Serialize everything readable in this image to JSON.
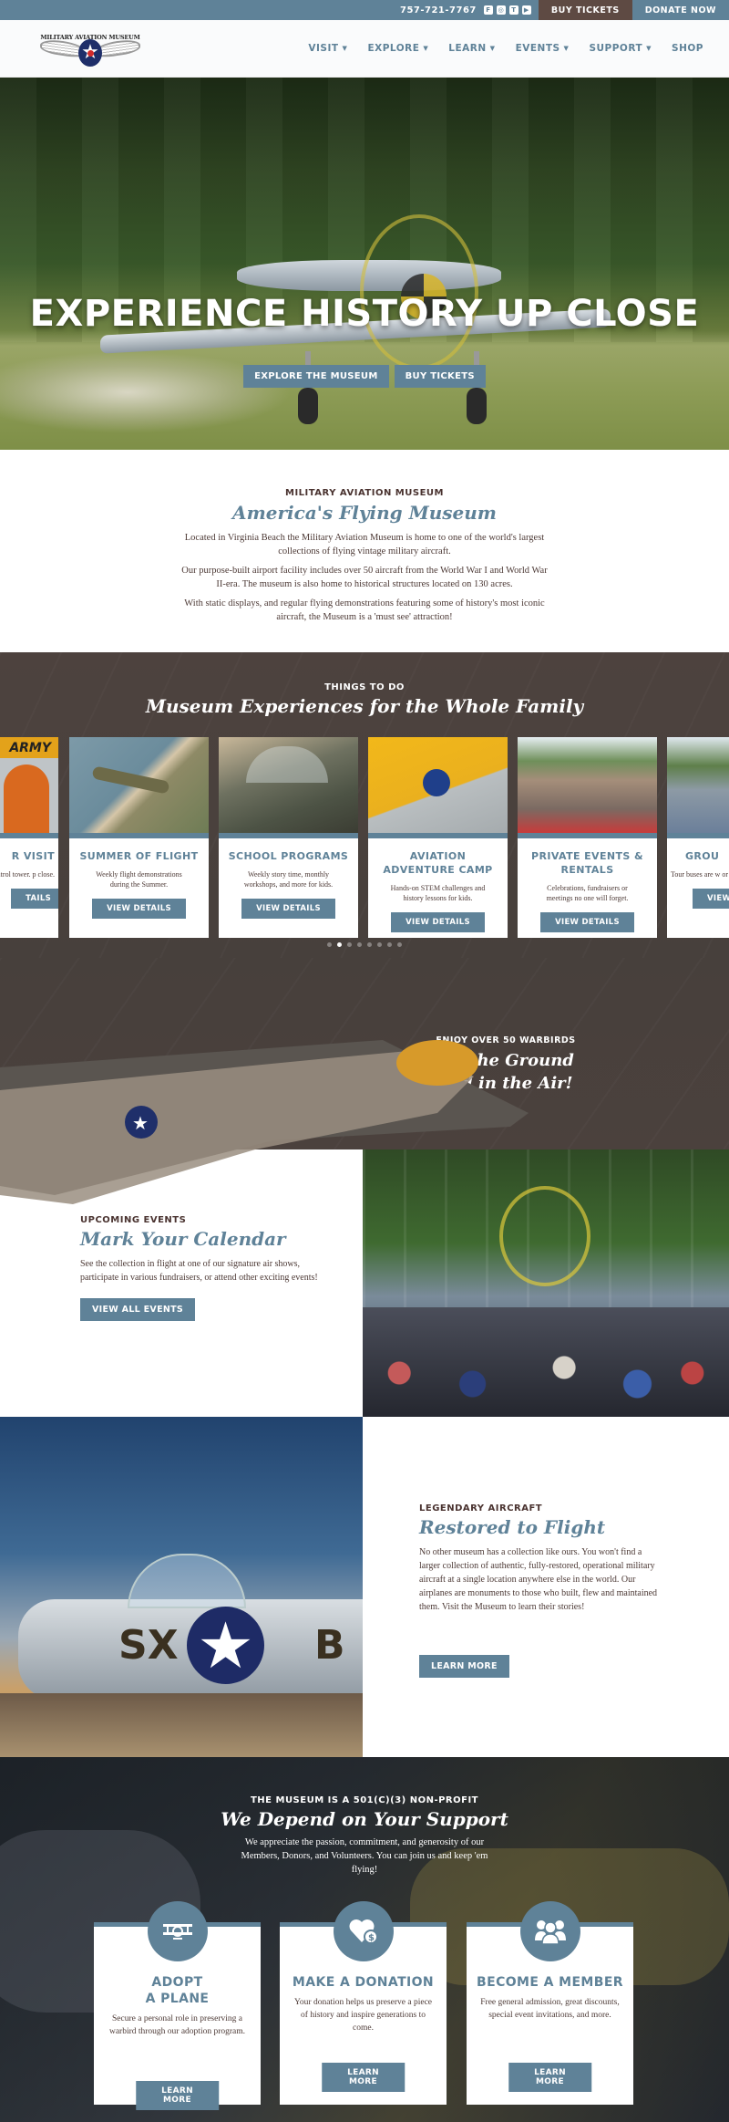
{
  "topbar": {
    "phone": "757-721-7767",
    "socials": [
      "facebook-icon",
      "instagram-icon",
      "twitter-icon",
      "youtube-icon"
    ],
    "buy_tickets": "Buy Tickets",
    "donate_now": "Donate Now"
  },
  "header": {
    "logo_text": "MILITARY AVIATION MUSEUM",
    "nav": [
      {
        "label": "Visit",
        "has_dropdown": true
      },
      {
        "label": "Explore",
        "has_dropdown": true
      },
      {
        "label": "Learn",
        "has_dropdown": true
      },
      {
        "label": "Events",
        "has_dropdown": true
      },
      {
        "label": "Support",
        "has_dropdown": true
      },
      {
        "label": "Shop",
        "has_dropdown": false
      }
    ],
    "chevron": "⌄"
  },
  "hero": {
    "title": "EXPERIENCE HISTORY UP CLOSE",
    "buttons": [
      "Explore the Museum",
      "Buy Tickets"
    ]
  },
  "intro": {
    "eyebrow": "Military Aviation Museum",
    "title": "America's Flying Museum",
    "paragraphs": [
      "Located in Virginia Beach the Military Aviation Museum is home to one of the world's largest collections of flying vintage military aircraft.",
      "Our purpose-built airport facility includes over 50 aircraft from the World War I and World War II-era. The museum is also home to historical structures located on 130 acres.",
      "With static displays, and regular flying demonstrations featuring some of history's most iconic aircraft, the Museum is a 'must see' attraction!"
    ]
  },
  "things": {
    "eyebrow": "Things to Do",
    "title": "Museum Experiences for the Whole Family",
    "cards": [
      {
        "title": "R VISIT",
        "desc": "control tower. p close.",
        "button": "TAILS"
      },
      {
        "title": "Summer of Flight",
        "desc": "Weekly flight demonstrations during the Summer.",
        "button": "View Details"
      },
      {
        "title": "School Programs",
        "desc": "Weekly story time, monthly workshops, and more for kids.",
        "button": "View Details"
      },
      {
        "title": "Aviation Adventure Camp",
        "desc": "Hands-on STEM challenges and history lessons for kids.",
        "button": "View Details"
      },
      {
        "title": "Private Events & Rentals",
        "desc": "Celebrations, fundraisers or meetings no one will forget.",
        "button": "View Details"
      },
      {
        "title": "GROU",
        "desc": "Tour buses are w or witl",
        "button": "VIEW"
      }
    ],
    "dots_total": 8,
    "dots_active_index": 1
  },
  "warbirds": {
    "eyebrow": "Enjoy Over 50 Warbirds",
    "title_line1": "On the Ground",
    "title_line2": "and in the Air!"
  },
  "events": {
    "eyebrow": "Upcoming Events",
    "title": "Mark Your Calendar",
    "body": "See the collection in flight at one of our signature air shows, participate in various fundraisers, or attend other exciting events!",
    "button": "View All Events"
  },
  "legendary": {
    "eyebrow": "Legendary Aircraft",
    "title": "Restored to Flight",
    "body": "No other museum has a collection like ours. You won't find a larger collection of authentic, fully-restored, operational military aircraft at a single location anywhere else in the world. Our airplanes are monuments to those who built, flew and maintained them. Visit the Museum to learn their stories!",
    "button": "Learn More",
    "plane_code": "SX",
    "plane_letter": "B"
  },
  "support": {
    "eyebrow": "The Museum is a 501(c)(3) Non-Profit",
    "title": "We Depend on Your Support",
    "body": "We appreciate the passion, commitment, and generosity of our Members, Donors, and Volunteers. You can join us and keep 'em flying!",
    "cards": [
      {
        "icon": "biplane-icon",
        "title_line1": "Adopt",
        "title_line2": "a Plane",
        "desc": "Secure a personal role in preserving a warbird through our adoption program.",
        "button": "Learn More"
      },
      {
        "icon": "heart-dollar-icon",
        "title_line1": "Make a Donation",
        "title_line2": "",
        "desc": "Your donation helps us preserve a piece of history and inspire generations to come.",
        "button": "Learn More"
      },
      {
        "icon": "group-icon",
        "title_line1": "Become a Member",
        "title_line2": "",
        "desc": "Free general admission, great discounts, special event invitations, and more.",
        "button": "Learn More"
      }
    ]
  },
  "colors": {
    "brand_blue": "#5f8298",
    "brand_brown": "#5e4a43",
    "dark_band": "#4a3f3b",
    "text": "#4d3a36"
  }
}
